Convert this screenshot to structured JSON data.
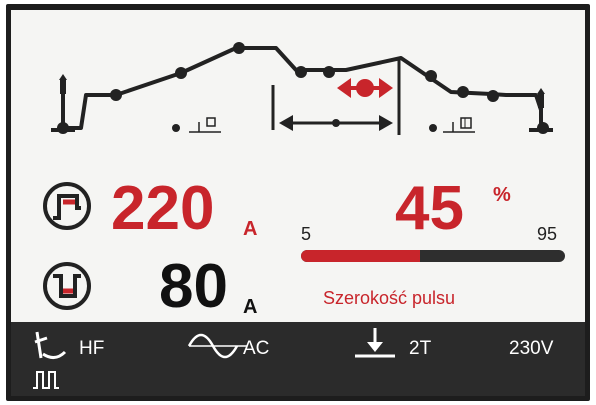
{
  "current_peak": {
    "value": "220",
    "unit": "A",
    "icon": "pulse-high-icon"
  },
  "current_base": {
    "value": "80",
    "unit": "A",
    "icon": "pulse-low-icon"
  },
  "pulse_width": {
    "value": "45",
    "unit": "%",
    "min": "5",
    "max": "95",
    "fraction": 0.45,
    "label": "Szerokość pulsu"
  },
  "status": {
    "hf": "HF",
    "ac": "AC",
    "mode": "2T",
    "voltage": "230V"
  },
  "colors": {
    "accent": "#c8252b",
    "lcd_bg": "#f5f5f3",
    "status_bg": "#2b2b2b"
  }
}
